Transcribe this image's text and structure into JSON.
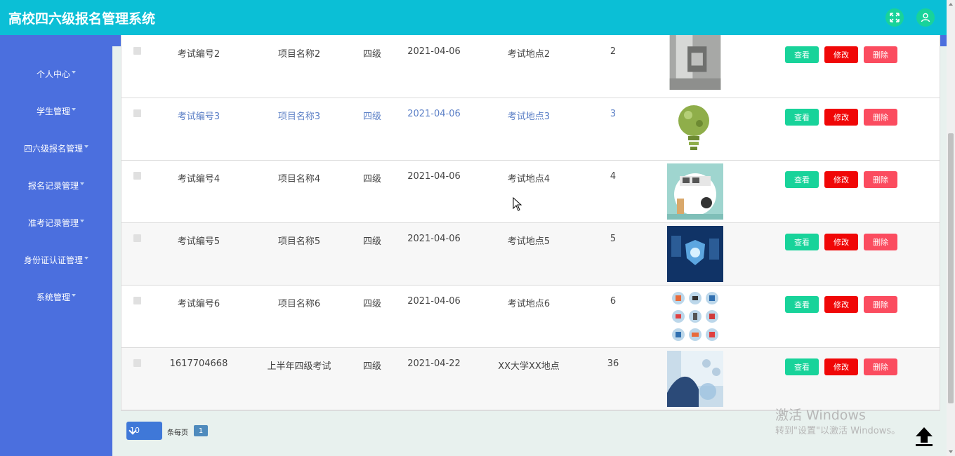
{
  "header": {
    "title": "高校四六级报名管理系统"
  },
  "sidebar": {
    "items": [
      {
        "label": "个人中心"
      },
      {
        "label": "学生管理"
      },
      {
        "label": "四六级报名管理"
      },
      {
        "label": "报名记录管理"
      },
      {
        "label": "准考记录管理"
      },
      {
        "label": "身份证认证管理"
      },
      {
        "label": "系统管理"
      }
    ]
  },
  "actions": {
    "view": "查看",
    "edit": "修改",
    "delete": "删除"
  },
  "rows": [
    {
      "exam_no": "考试编号2",
      "project": "项目名称2",
      "level": "四级",
      "date": "2021-04-06",
      "place": "考试地点2",
      "count": "2",
      "image": "machine"
    },
    {
      "exam_no": "考试编号3",
      "project": "项目名称3",
      "level": "四级",
      "date": "2021-04-06",
      "place": "考试地点3",
      "count": "3",
      "image": "lightbulb"
    },
    {
      "exam_no": "考试编号4",
      "project": "项目名称4",
      "level": "四级",
      "date": "2021-04-06",
      "place": "考试地点4",
      "count": "4",
      "image": "scientist"
    },
    {
      "exam_no": "考试编号5",
      "project": "项目名称5",
      "level": "四级",
      "date": "2021-04-06",
      "place": "考试地点5",
      "count": "5",
      "image": "tech-shield"
    },
    {
      "exam_no": "考试编号6",
      "project": "项目名称6",
      "level": "四级",
      "date": "2021-04-06",
      "place": "考试地点6",
      "count": "6",
      "image": "icon-grid"
    },
    {
      "exam_no": "1617704668",
      "project": "上半年四级考试",
      "level": "四级",
      "date": "2021-04-22",
      "place": "XX大学XX地点",
      "count": "36",
      "image": "lab-glove"
    }
  ],
  "pagination": {
    "page_size": "10",
    "per_page_label": "条每页",
    "current_page": "1"
  },
  "watermark": {
    "line1": "激活 Windows",
    "line2": "转到\"设置\"以激活 Windows。"
  },
  "colors": {
    "header": "#0bbfd6",
    "sidebar": "#4b6fde",
    "view": "#18d39a",
    "edit": "#f00707",
    "delete": "#fb4c5f"
  }
}
